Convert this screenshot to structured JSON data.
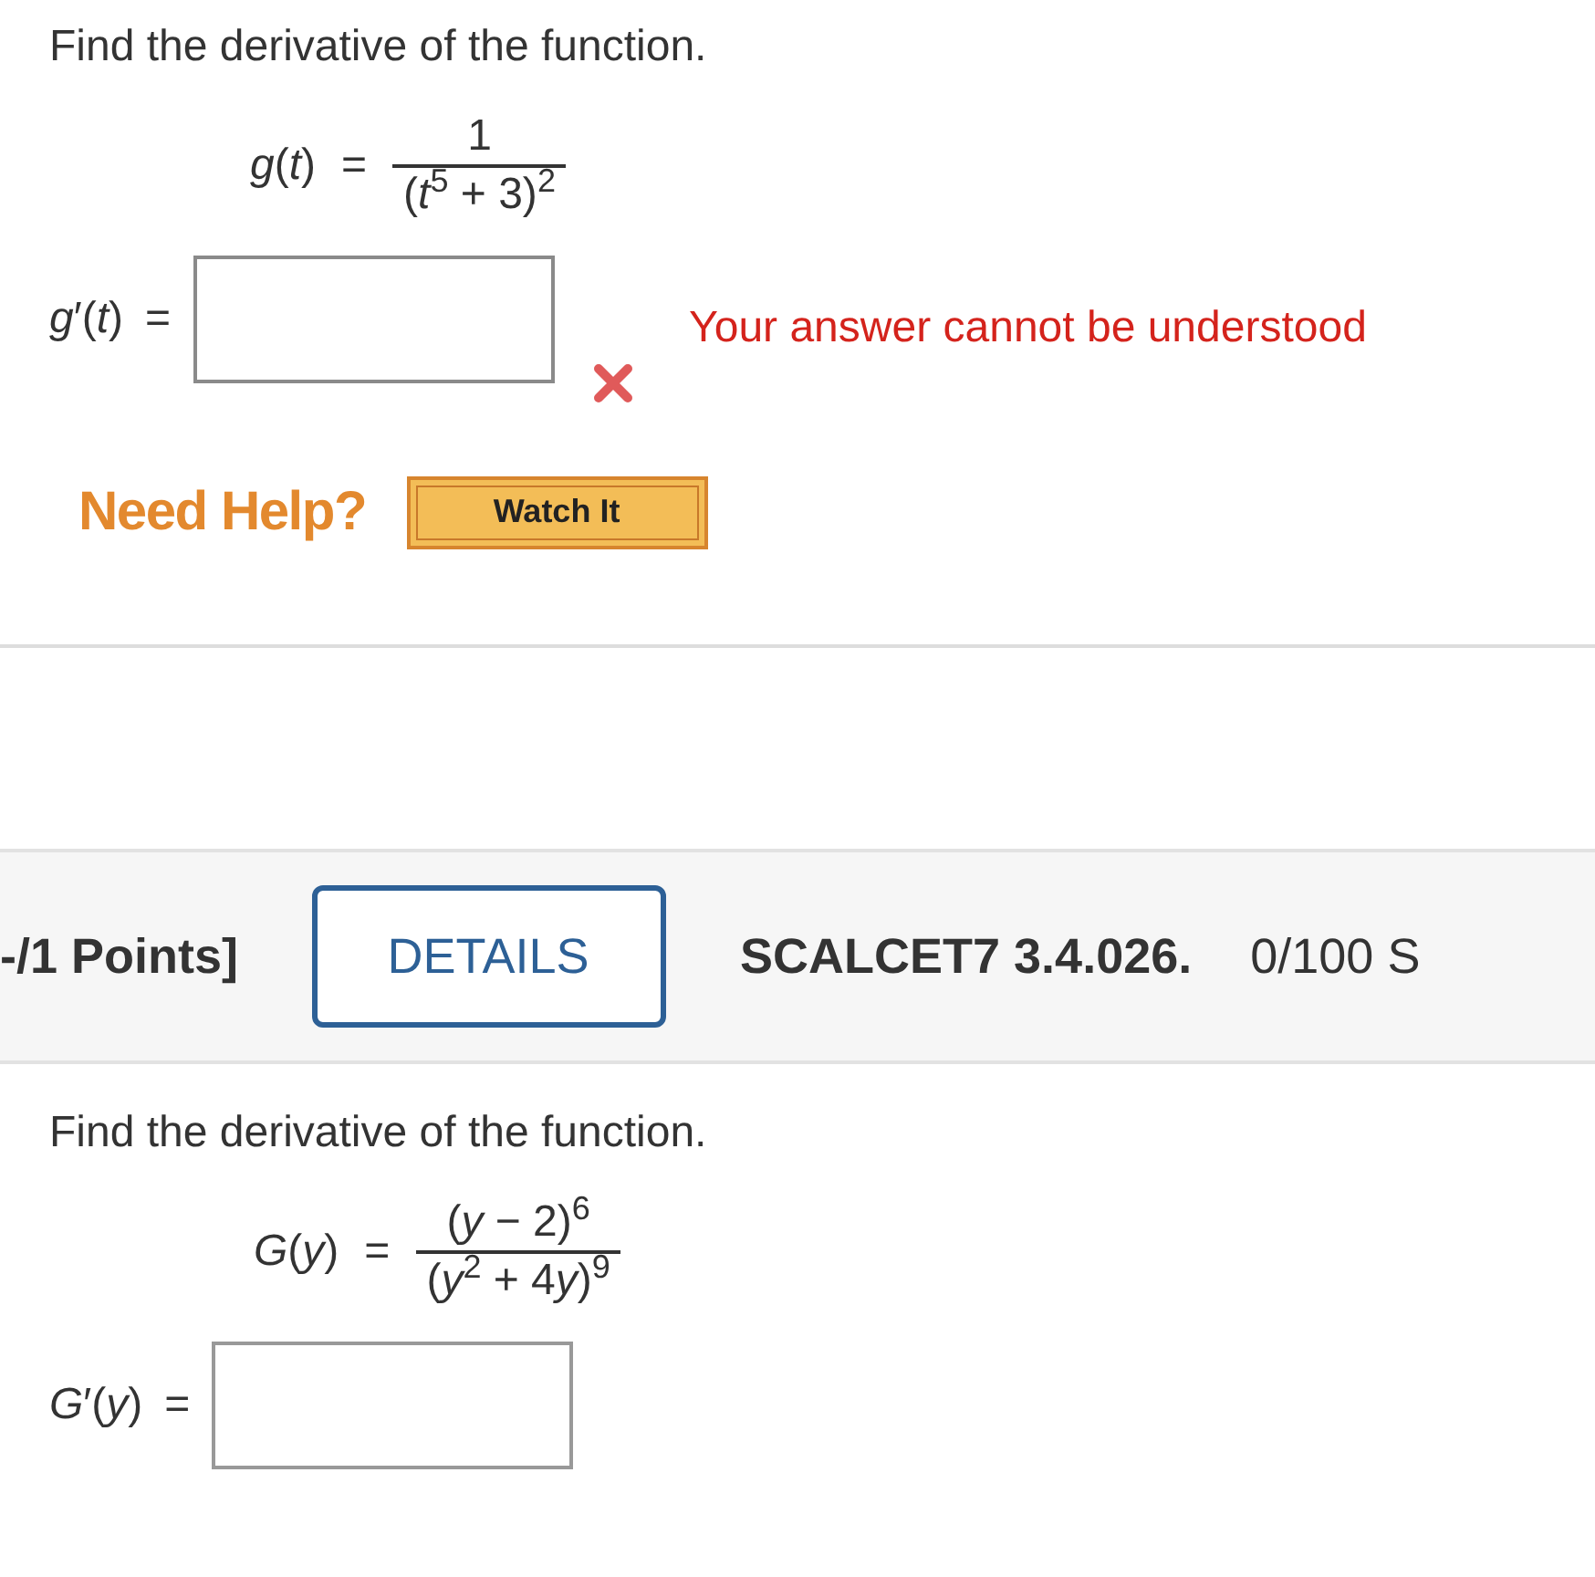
{
  "problems": [
    {
      "prompt": "Find the derivative of the function.",
      "function": {
        "lhs": "*g*(*t*)",
        "equals": "=",
        "numerator": "1",
        "denominator": "(*t*$^{5}$ + 3)$^{2}$"
      },
      "answer": {
        "label": "*g*′(*t*)",
        "equals": "=",
        "incorrect": true,
        "feedback": "Your answer cannot be understood"
      },
      "help": {
        "label": "Need Help?",
        "buttons": [
          "Watch It"
        ]
      }
    },
    {
      "header": {
        "points": "-/1 Points]",
        "details_button": "DETAILS",
        "problem_id": "SCALCET7 3.4.026.",
        "submissions": "0/100 S"
      },
      "prompt": "Find the derivative of the function.",
      "function": {
        "lhs": "*G*(*y*)",
        "equals": "=",
        "numerator": "(*y* − 2)$^{6}$",
        "denominator": "(*y*$^{2}$ + 4​*y*)$^{9}$"
      },
      "answer": {
        "label": "*G*′(*y*)",
        "equals": "=",
        "incorrect": false
      }
    }
  ]
}
